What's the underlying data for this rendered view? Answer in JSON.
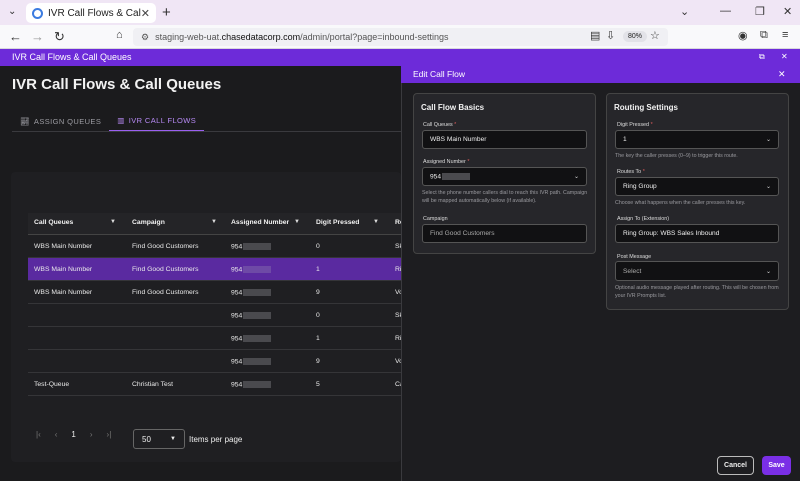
{
  "browser": {
    "tab_title": "IVR Call Flows & Call Queues",
    "url_prefix": "staging-web-uat.",
    "url_domain": "chasedatacorp.com",
    "url_path": "/admin/portal?page=inbound-settings",
    "zoom": "80%"
  },
  "app": {
    "bar_title": "IVR Call Flows & Call Queues",
    "page_title": "IVR Call Flows & Call Queues",
    "tabs": [
      {
        "label": "ASSIGN QUEUES",
        "icon": "chart-icon"
      },
      {
        "label": "IVR CALL FLOWS",
        "icon": "bar-chart-icon"
      }
    ]
  },
  "table": {
    "headers": [
      "Call Queues",
      "Campaign",
      "Assigned Number",
      "Digit Pressed",
      "Ro"
    ],
    "rows": [
      {
        "queue": "WBS Main Number",
        "campaign": "Find Good Customers",
        "number": "954",
        "digit": "0",
        "route": "Sk"
      },
      {
        "queue": "WBS Main Number",
        "campaign": "Find Good Customers",
        "number": "954",
        "digit": "1",
        "route": "Rin"
      },
      {
        "queue": "WBS Main Number",
        "campaign": "Find Good Customers",
        "number": "954",
        "digit": "9",
        "route": "Vo"
      },
      {
        "queue": "",
        "campaign": "",
        "number": "954",
        "digit": "0",
        "route": "Sk"
      },
      {
        "queue": "",
        "campaign": "",
        "number": "954",
        "digit": "1",
        "route": "Rin"
      },
      {
        "queue": "",
        "campaign": "",
        "number": "954",
        "digit": "9",
        "route": "Vo"
      },
      {
        "queue": "Test-Queue",
        "campaign": "Christian Test",
        "number": "954",
        "digit": "5",
        "route": "Ca"
      }
    ],
    "selected_row": 1
  },
  "pagination": {
    "current_page": "1",
    "page_size": "50",
    "items_per_page_label": "Items per page"
  },
  "panel": {
    "title": "Edit Call Flow",
    "basics": {
      "title": "Call Flow Basics",
      "call_queues_label": "Call Queues",
      "call_queues_value": "WBS Main Number",
      "assigned_number_label": "Assigned Number",
      "assigned_number_value": "954",
      "assigned_number_hint": "Select the phone number callers dial to reach this IVR path. Campaign will be mapped automatically below (if available).",
      "campaign_label": "Campaign",
      "campaign_value": "Find Good Customers"
    },
    "routing": {
      "title": "Routing Settings",
      "digit_label": "Digit Pressed",
      "digit_value": "1",
      "digit_hint": "The key the caller presses (0–9) to trigger this route.",
      "routes_label": "Routes To",
      "routes_value": "Ring Group",
      "routes_hint": "Choose what happens when the caller presses this key.",
      "assign_label": "Assign To (Extension)",
      "assign_value": "Ring Group: WBS Sales Inbound",
      "post_label": "Post Message",
      "post_placeholder": "Select",
      "post_hint": "Optional audio message played after routing. This will be chosen from your IVR Prompts list."
    },
    "cancel_label": "Cancel",
    "save_label": "Save"
  },
  "colors": {
    "accent": "#6d2bd9",
    "selected_row": "#5a2aa0",
    "save_button": "#7a2fe6"
  }
}
